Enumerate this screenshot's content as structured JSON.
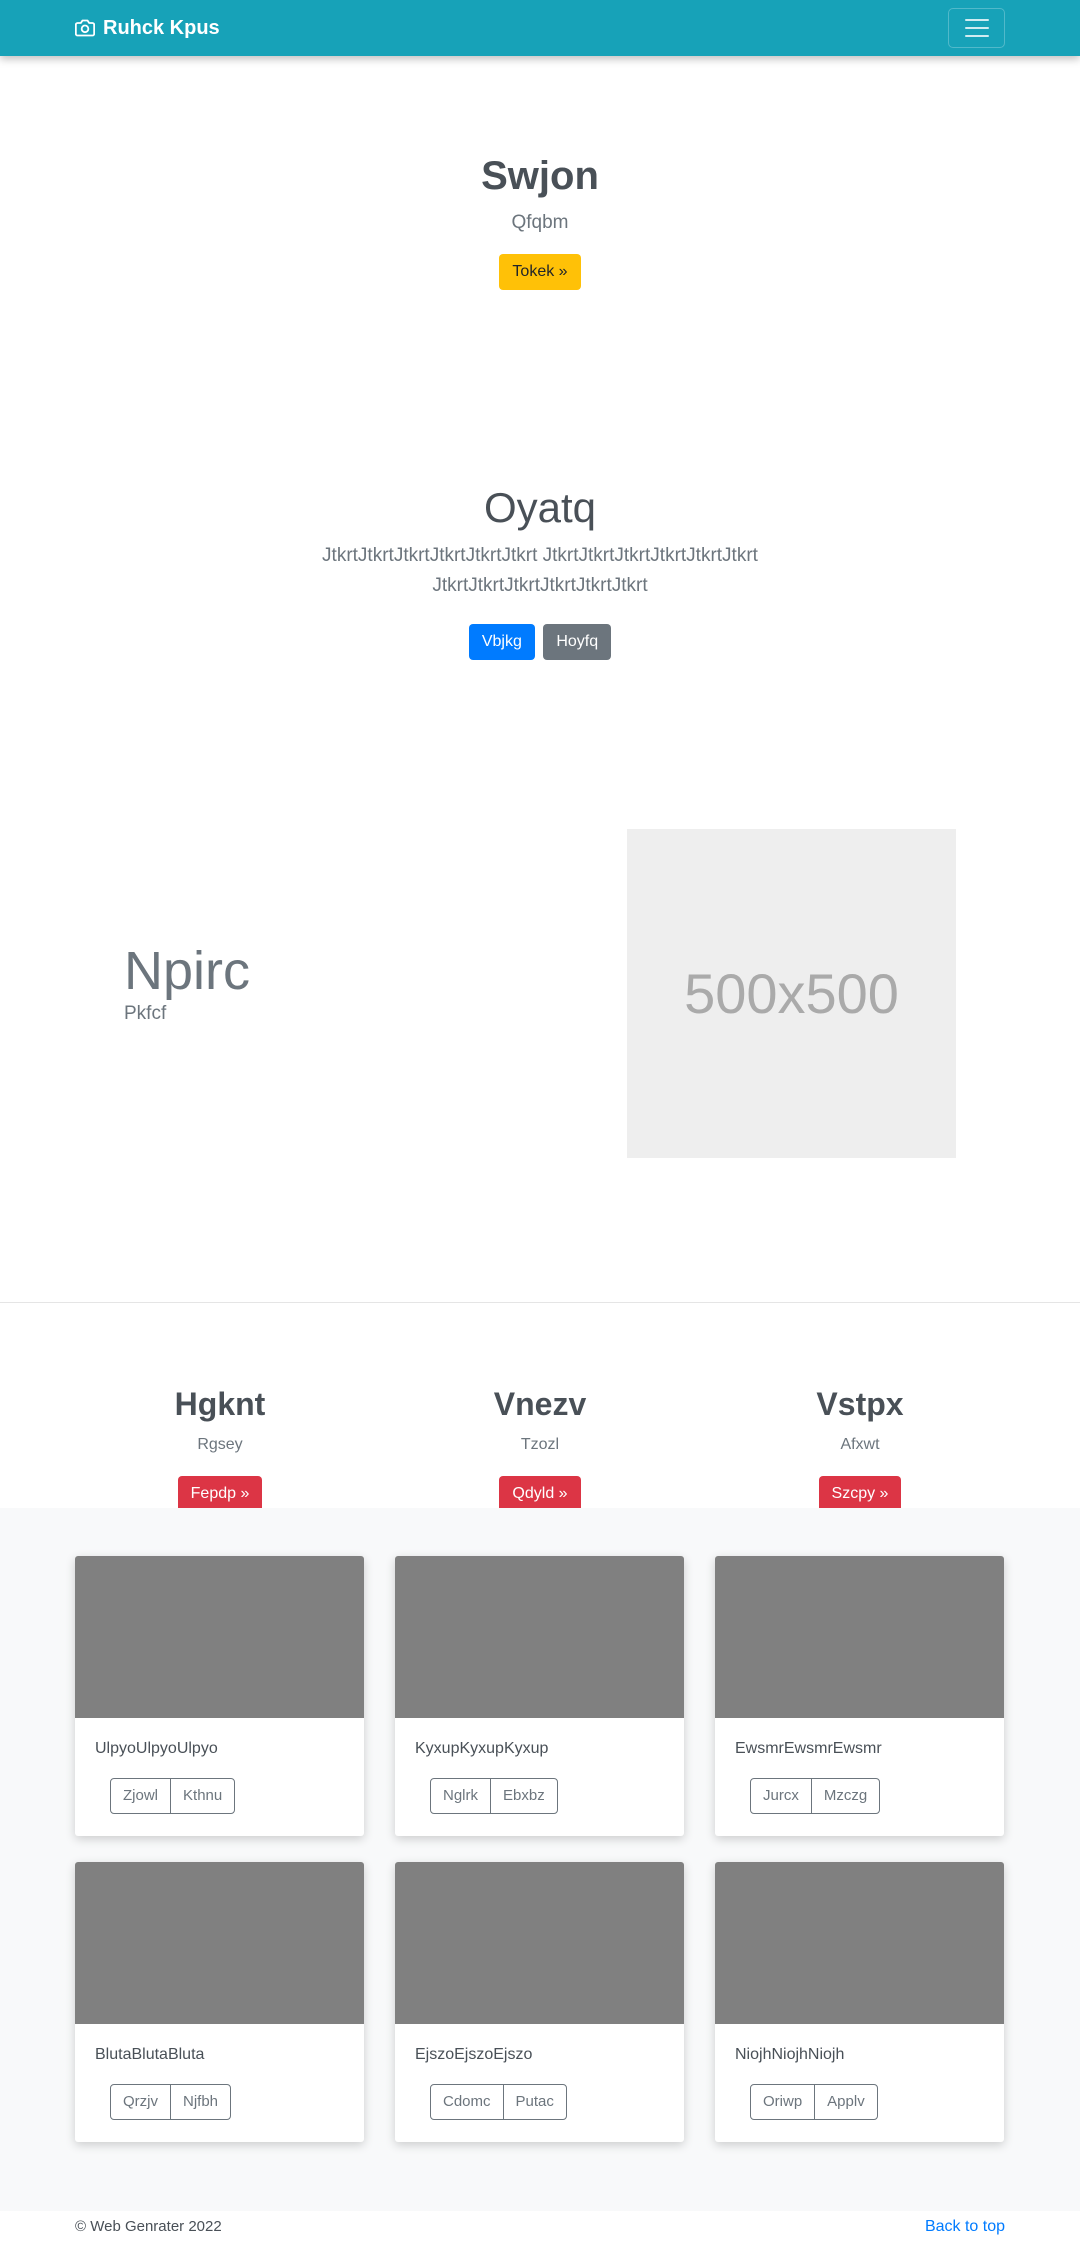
{
  "navbar": {
    "brand": "Ruhck Kpus",
    "brand_icon": "camera-icon",
    "menu_icon": "hamburger-icon"
  },
  "hero": {
    "title": "Swjon",
    "subtitle": "Qfqbm",
    "button": "Tokek »"
  },
  "jumbotron": {
    "title": "Oyatq",
    "lead": "JtkrtJtkrtJtkrtJtkrtJtkrtJtkrt JtkrtJtkrtJtkrtJtkrtJtkrtJtkrt JtkrtJtkrtJtkrtJtkrtJtkrtJtkrt",
    "primary_button": "Vbjkg",
    "secondary_button": "Hoyfq"
  },
  "feature": {
    "title": "Npirc",
    "subtitle": "Pkfcf",
    "image_label": "500x500"
  },
  "columns": [
    {
      "title": "Hgknt",
      "subtitle": "Rgsey",
      "button": "Fepdp »"
    },
    {
      "title": "Vnezv",
      "subtitle": "Tzozl",
      "button": "Qdyld »"
    },
    {
      "title": "Vstpx",
      "subtitle": "Afxwt",
      "button": "Szcpy »"
    }
  ],
  "cards": [
    {
      "text": "UlpyoUlpyoUlpyo",
      "btn1": "Zjowl",
      "btn2": "Kthnu"
    },
    {
      "text": "KyxupKyxupKyxup",
      "btn1": "Nglrk",
      "btn2": "Ebxbz"
    },
    {
      "text": "EwsmrEwsmrEwsmr",
      "btn1": "Jurcx",
      "btn2": "Mzczg"
    },
    {
      "text": "BlutaBlutaBluta",
      "btn1": "Qrzjv",
      "btn2": "Njfbh"
    },
    {
      "text": "EjszoEjszoEjszo",
      "btn1": "Cdomc",
      "btn2": "Putac"
    },
    {
      "text": "NiojhNiojhNiojh",
      "btn1": "Oriwp",
      "btn2": "Applv"
    }
  ],
  "footer": {
    "copyright": "© Web Genrater 2022",
    "back_to_top": "Back to top"
  }
}
